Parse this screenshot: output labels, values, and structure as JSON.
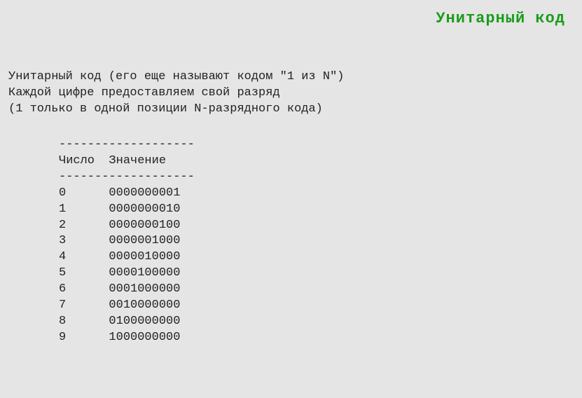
{
  "title": "Унитарный код",
  "description": {
    "line1": "Унитарный код (его еще называют кодом \"1 из N\")",
    "line2": "Каждой цифре предоставляем свой разряд",
    "line3": "(1 только в одной позиции N-разрядного кода)"
  },
  "table": {
    "divider": "-------------------",
    "header": "Число  Значение",
    "rows": [
      {
        "num": "0",
        "val": "0000000001"
      },
      {
        "num": "1",
        "val": "0000000010"
      },
      {
        "num": "2",
        "val": "0000000100"
      },
      {
        "num": "3",
        "val": "0000001000"
      },
      {
        "num": "4",
        "val": "0000010000"
      },
      {
        "num": "5",
        "val": "0000100000"
      },
      {
        "num": "6",
        "val": "0001000000"
      },
      {
        "num": "7",
        "val": "0010000000"
      },
      {
        "num": "8",
        "val": "0100000000"
      },
      {
        "num": "9",
        "val": "1000000000"
      }
    ]
  }
}
